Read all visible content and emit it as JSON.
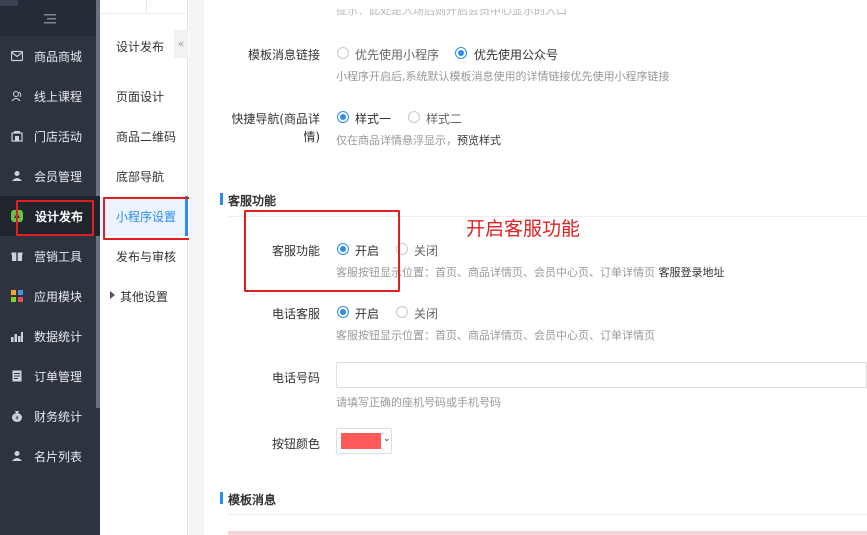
{
  "sidebar": {
    "items": [
      {
        "label": "商品商城",
        "icon": "mail-icon"
      },
      {
        "label": "线上课程",
        "icon": "people-icon"
      },
      {
        "label": "门店活动",
        "icon": "store-icon"
      },
      {
        "label": "会员管理",
        "icon": "user-icon"
      },
      {
        "label": "设计发布",
        "icon": "design-icon",
        "active": true
      },
      {
        "label": "营销工具",
        "icon": "gift-icon"
      },
      {
        "label": "应用模块",
        "icon": "apps-icon"
      },
      {
        "label": "数据统计",
        "icon": "stats-icon"
      },
      {
        "label": "订单管理",
        "icon": "order-icon"
      },
      {
        "label": "财务统计",
        "icon": "money-bag-icon"
      },
      {
        "label": "名片列表",
        "icon": "card-icon"
      }
    ]
  },
  "submenu": {
    "title": "设计发布",
    "collapse": "«",
    "items": [
      {
        "label": "页面设计"
      },
      {
        "label": "商品二维码"
      },
      {
        "label": "底部导航"
      },
      {
        "label": "小程序设置",
        "active": true
      },
      {
        "label": "发布与审核"
      },
      {
        "label": "其他设置",
        "expandable": true
      }
    ]
  },
  "main": {
    "top_faded": "提示：此处是入场后则开启会员中心显示的入口",
    "template_link": {
      "label": "模板消息链接",
      "options": [
        "优先使用小程序",
        "优先使用公众号"
      ],
      "selected": 1,
      "hint": "小程序开启后,系统默认模板消息使用的详情链接优先使用小程序链接"
    },
    "quick_nav": {
      "label_line1": "快捷导航(商品详",
      "label_line2": "情)",
      "options": [
        "样式一",
        "样式二"
      ],
      "selected": 0,
      "hint_prefix": "仅在商品详情悬浮显示，",
      "hint_link": "预览样式"
    },
    "section_cs": "客服功能",
    "cs": {
      "label": "客服功能",
      "options": [
        "开启",
        "关闭"
      ],
      "selected": 0,
      "hint_prefix": "客服按钮显示位置：首页、商品详情页、会员中心页、订单详情页 ",
      "hint_link": "客服登录地址"
    },
    "annotation": "开启客服功能",
    "phone_cs": {
      "label": "电话客服",
      "options": [
        "开启",
        "关闭"
      ],
      "selected": 0,
      "hint": "客服按钮显示位置：首页、商品详情页、会员中心页、订单详情页"
    },
    "phone_number": {
      "label": "电话号码",
      "value": "",
      "hint": "请填写正确的座机号码或手机号码"
    },
    "button_color": {
      "label": "按钮颜色",
      "color": "#ff5a5a",
      "caret": "⌄"
    },
    "section_template": "模板消息"
  },
  "colors": {
    "sidebar_bg": "#2d3440",
    "accent": "#2d8cf0",
    "annotation": "#e02020"
  }
}
